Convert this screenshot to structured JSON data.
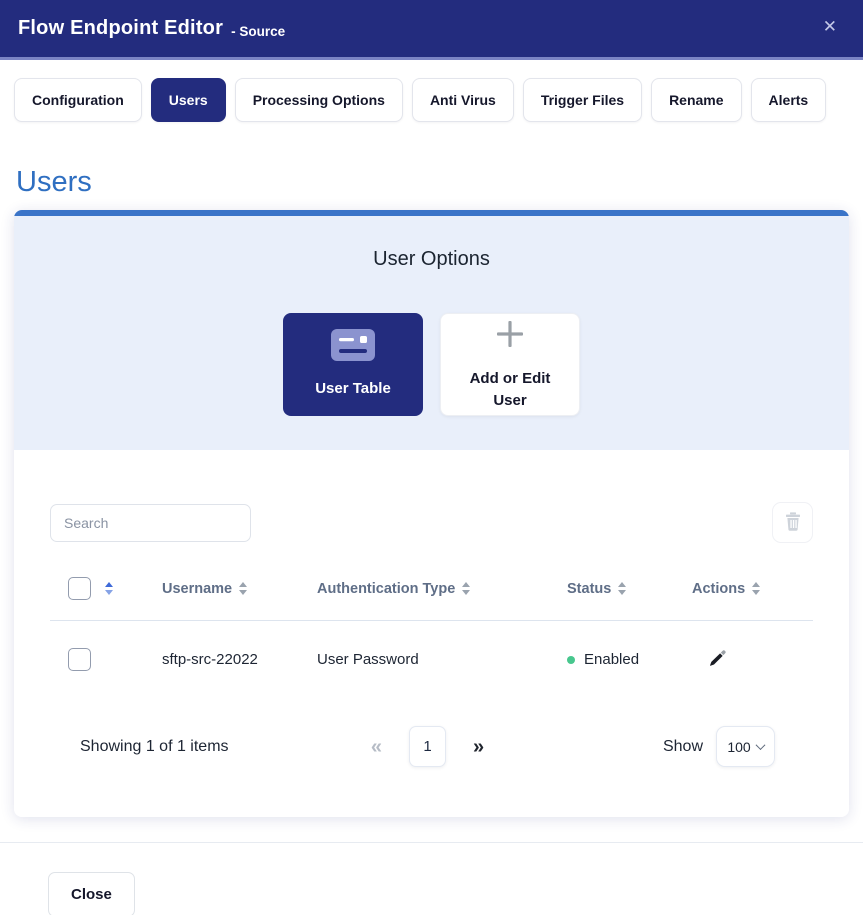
{
  "header": {
    "title": "Flow Endpoint Editor",
    "subtitle": "- Source",
    "close_glyph": "✕"
  },
  "tabs": [
    {
      "label": "Configuration",
      "active": false
    },
    {
      "label": "Users",
      "active": true
    },
    {
      "label": "Processing Options",
      "active": false
    },
    {
      "label": "Anti Virus",
      "active": false
    },
    {
      "label": "Trigger Files",
      "active": false
    },
    {
      "label": "Rename",
      "active": false
    },
    {
      "label": "Alerts",
      "active": false
    }
  ],
  "section": {
    "heading": "Users"
  },
  "user_options": {
    "title": "User Options",
    "buttons": [
      {
        "label": "User Table",
        "icon": "id-card-icon",
        "active": true
      },
      {
        "label": "Add or Edit User",
        "icon": "plus-icon",
        "active": false
      }
    ]
  },
  "toolbar": {
    "search_placeholder": "Search",
    "search_value": "",
    "delete_icon": "trash-icon"
  },
  "table": {
    "headers": [
      {
        "label": "Username"
      },
      {
        "label": "Authentication Type"
      },
      {
        "label": "Status"
      },
      {
        "label": "Actions"
      }
    ],
    "rows": [
      {
        "username": "sftp-src-22022",
        "authentication_type": "User Password",
        "status": "Enabled",
        "status_color": "#48c78e",
        "action_icon": "edit-pencil-icon"
      }
    ]
  },
  "pagination": {
    "summary": "Showing 1 of 1 items",
    "prev_glyph": "«",
    "current_page": "1",
    "next_glyph": "»",
    "show_label": "Show",
    "page_size": "100"
  },
  "footer": {
    "close_label": "Close"
  },
  "colors": {
    "navy": "#232c7e",
    "panel_accent": "#3a74c8",
    "heading_blue": "#2f6fc1",
    "panel_bg": "#e9effa",
    "status_green": "#48c78e"
  }
}
